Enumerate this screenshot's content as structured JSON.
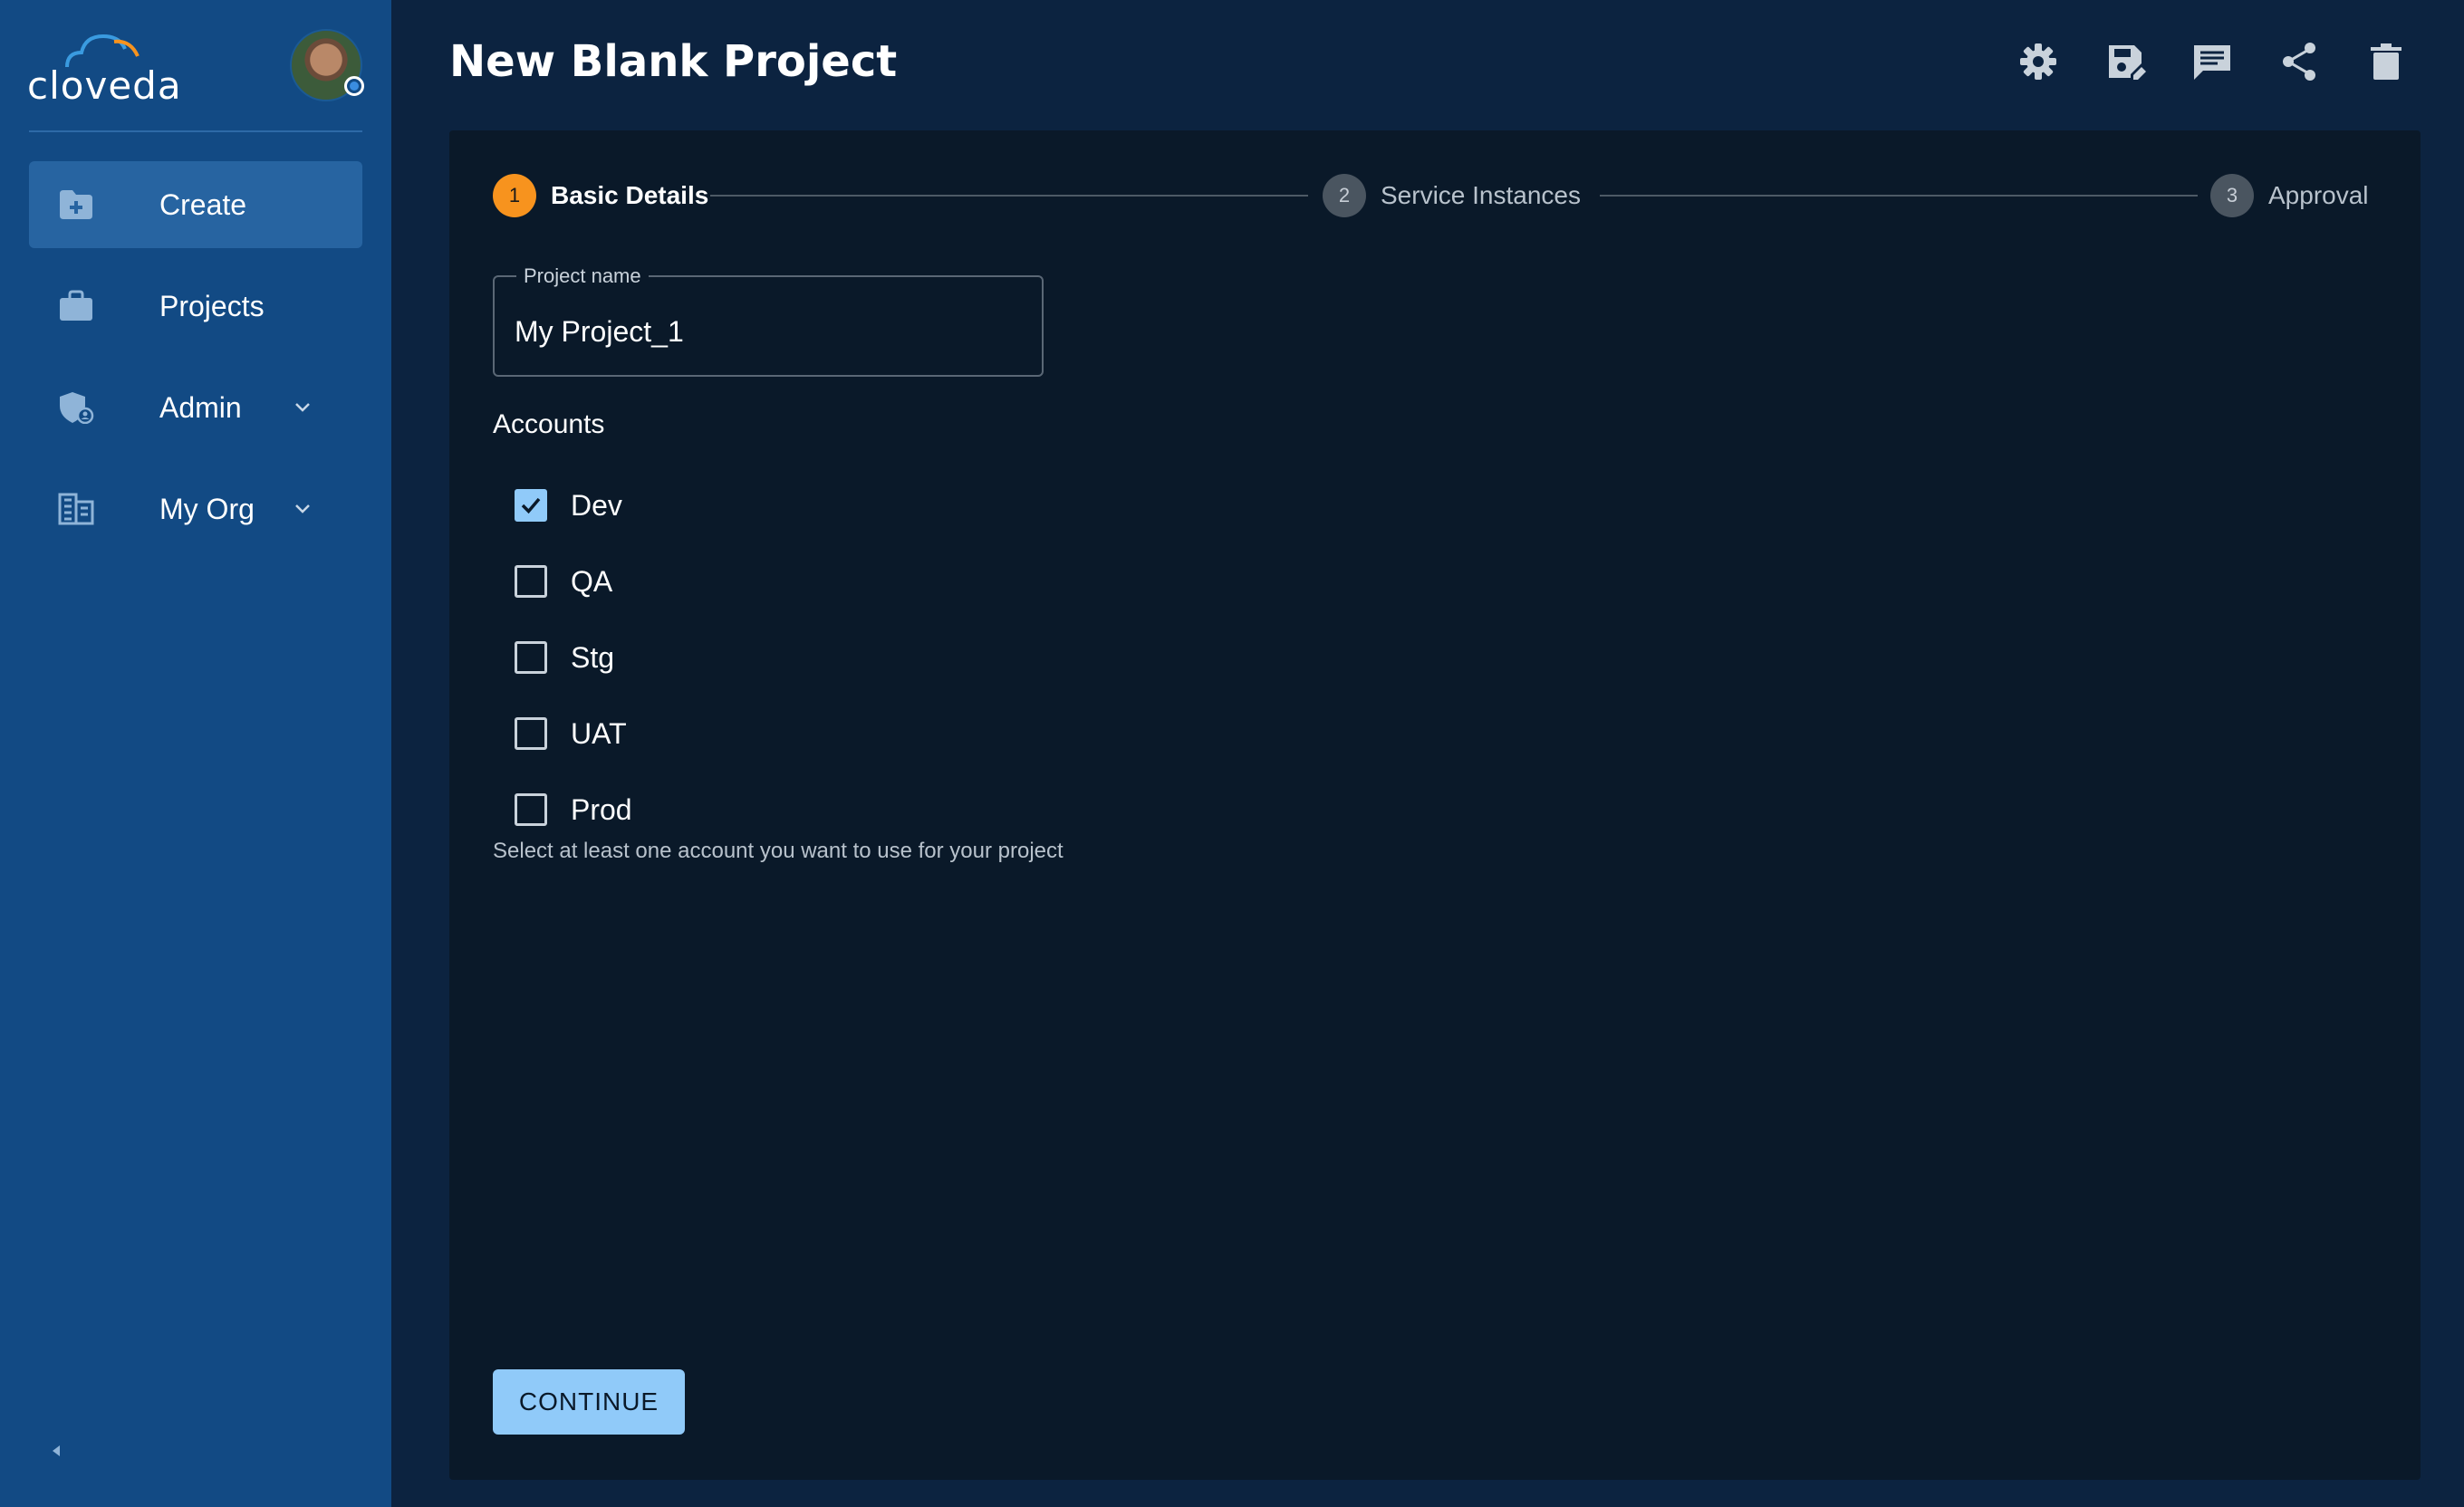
{
  "brand": {
    "name": "cloveda"
  },
  "sidebar": {
    "items": [
      {
        "label": "Create",
        "icon": "folder-plus-icon",
        "active": true
      },
      {
        "label": "Projects",
        "icon": "briefcase-icon",
        "active": false
      },
      {
        "label": "Admin",
        "icon": "admin-shield-icon",
        "active": false,
        "expandable": true
      },
      {
        "label": "My Org",
        "icon": "organization-icon",
        "active": false,
        "expandable": true
      }
    ]
  },
  "header": {
    "title": "New Blank Project",
    "actions": [
      "settings-icon",
      "save-edit-icon",
      "comment-icon",
      "share-icon",
      "delete-icon"
    ]
  },
  "stepper": {
    "steps": [
      {
        "number": "1",
        "label": "Basic Details",
        "state": "active"
      },
      {
        "number": "2",
        "label": "Service Instances",
        "state": "pending"
      },
      {
        "number": "3",
        "label": "Approval",
        "state": "pending"
      }
    ]
  },
  "form": {
    "project_name_label": "Project name",
    "project_name_value": "My Project_1",
    "accounts_title": "Accounts",
    "accounts": [
      {
        "label": "Dev",
        "checked": true
      },
      {
        "label": "QA",
        "checked": false
      },
      {
        "label": "Stg",
        "checked": false
      },
      {
        "label": "UAT",
        "checked": false
      },
      {
        "label": "Prod",
        "checked": false
      }
    ],
    "helper_text": "Select at least one account you want to use for your project",
    "continue_label": "CONTINUE"
  },
  "colors": {
    "sidebar_bg": "#124a84",
    "page_bg": "#0c2340",
    "card_bg": "#0a1929",
    "accent": "#90caf9",
    "step_active": "#f7931e"
  }
}
